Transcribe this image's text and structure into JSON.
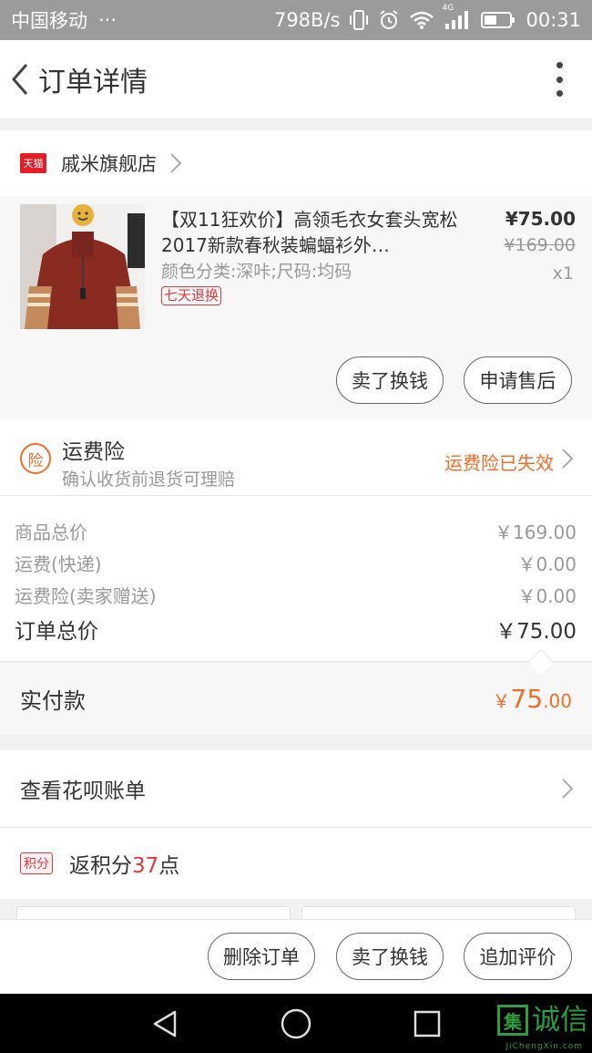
{
  "status_bar": {
    "carrier": "中国移动",
    "dots": "···",
    "speed": "798B/s",
    "network": "4G",
    "time": "00:31"
  },
  "header": {
    "title": "订单详情"
  },
  "shop": {
    "badge": "天猫",
    "name": "戚米旗舰店"
  },
  "product": {
    "title": "【双11狂欢价】高领毛衣女套头宽松2017新款春秋装蝙蝠衫外…",
    "attributes": "颜色分类:深咔;尺码:均码",
    "tag": "七天退换",
    "price": "¥75.00",
    "original_price": "¥169.00",
    "quantity": "x1",
    "buttons": [
      "卖了换钱",
      "申请售后"
    ]
  },
  "insurance": {
    "icon_text": "险",
    "title": "运费险",
    "subtitle": "确认收货前退货可理赔",
    "status": "运费险已失效"
  },
  "totals": {
    "rows": [
      {
        "label": "商品总价",
        "value": "￥169.00"
      },
      {
        "label": "运费(快递)",
        "value": "￥0.00"
      },
      {
        "label": "运费险(卖家赠送)",
        "value": "￥0.00"
      }
    ],
    "order_total_label": "订单总价",
    "order_total_value": "￥75.00"
  },
  "paid": {
    "label": "实付款",
    "currency": "￥",
    "amount_int": "75",
    "amount_dec": ".00"
  },
  "huabei": {
    "label": "查看花呗账单"
  },
  "points": {
    "icon_text": "积分",
    "prefix": "返积分",
    "value": "37",
    "suffix": "点"
  },
  "actions": {
    "buttons": [
      "删除订单",
      "卖了换钱",
      "追加评价"
    ]
  },
  "watermark": {
    "logo": "集",
    "text": "诚信",
    "sub": "JiChengXin.com"
  },
  "colors": {
    "accent_orange": "#f06d2a",
    "tmall_red": "#e21f26",
    "points_red": "#e4393c"
  }
}
